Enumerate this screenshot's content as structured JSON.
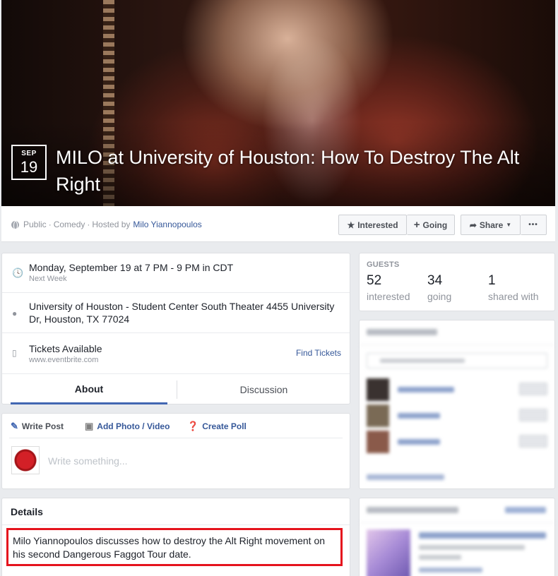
{
  "event": {
    "month": "SEP",
    "day": "19",
    "title": "MILO at University of Houston: How To Destroy The Alt Right",
    "meta": {
      "privacy": "Public",
      "category": "Comedy",
      "hosted_by_label": "Hosted by",
      "host": "Milo Yiannopoulos",
      "separator": "·"
    }
  },
  "actions": {
    "interested": "Interested",
    "going": "Going",
    "share": "Share",
    "more": "•••"
  },
  "info": {
    "datetime": "Monday, September 19 at 7 PM - 9 PM in CDT",
    "datetime_sub": "Next Week",
    "location": "University of Houston - Student Center South Theater 4455 University Dr, Houston, TX 77024",
    "tickets": "Tickets Available",
    "tickets_sub": "www.eventbrite.com",
    "find_tickets": "Find Tickets"
  },
  "tabs": [
    {
      "label": "About",
      "active": true
    },
    {
      "label": "Discussion",
      "active": false
    }
  ],
  "composer": {
    "write_post": "Write Post",
    "add_photo": "Add Photo / Video",
    "create_poll": "Create Poll",
    "placeholder": "Write something..."
  },
  "details": {
    "heading": "Details",
    "text": "Milo Yiannopoulos discusses how to destroy the Alt Right movement on his second Dangerous Faggot Tour date."
  },
  "guests": {
    "heading": "GUESTS",
    "stats": [
      {
        "count": "52",
        "label": "interested"
      },
      {
        "count": "34",
        "label": "going"
      },
      {
        "count": "1",
        "label": "shared with"
      }
    ]
  },
  "colors": {
    "link": "#365899",
    "highlight_border": "#e5131d",
    "active_tab": "#4267b2"
  }
}
